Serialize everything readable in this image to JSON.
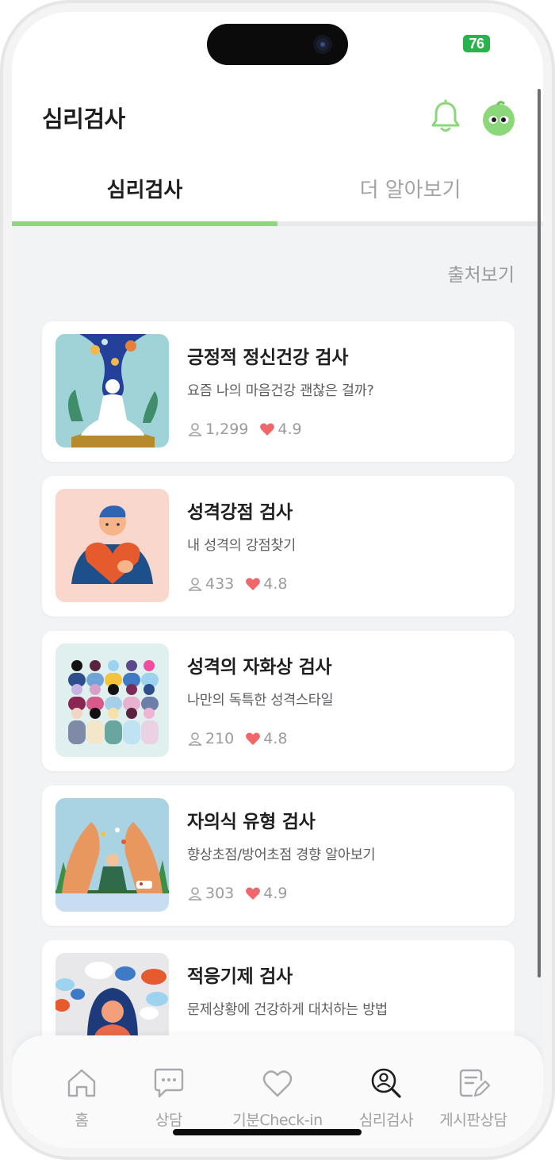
{
  "status_bar": {
    "battery": "76"
  },
  "header": {
    "title": "심리검사"
  },
  "tabs": [
    {
      "label": "심리검사",
      "active": true
    },
    {
      "label": "더 알아보기",
      "active": false
    }
  ],
  "source_link": "출처보기",
  "tests": [
    {
      "title": "긍정적 정신건강 검사",
      "subtitle": "요즘 나의 마음건강 괜찮은 걸까?",
      "participants": "1,299",
      "rating": "4.9",
      "thumb_bg": "#9fd3d8"
    },
    {
      "title": "성격강점 검사",
      "subtitle": "내 성격의 강점찾기",
      "participants": "433",
      "rating": "4.8",
      "thumb_bg": "#f9d7cc"
    },
    {
      "title": "성격의 자화상 검사",
      "subtitle": "나만의 독특한 성격스타일",
      "participants": "210",
      "rating": "4.8",
      "thumb_bg": "#dff0ee"
    },
    {
      "title": "자의식 유형 검사",
      "subtitle": "향상초점/방어초점 경향 알아보기",
      "participants": "303",
      "rating": "4.9",
      "thumb_bg": "#a9d3e2"
    },
    {
      "title": "적응기제 검사",
      "subtitle": "문제상황에 건강하게 대처하는 방법",
      "participants": "",
      "rating": "",
      "thumb_bg": "#e8e8ea"
    }
  ],
  "bottom_nav": [
    {
      "label": "홈",
      "icon": "home-icon",
      "active": false
    },
    {
      "label": "상담",
      "icon": "chat-bubble-icon",
      "active": false
    },
    {
      "label": "기분Check-in",
      "icon": "heart-icon",
      "active": false
    },
    {
      "label": "심리검사",
      "icon": "person-search-icon",
      "active": true
    },
    {
      "label": "게시판상담",
      "icon": "edit-note-icon",
      "active": false
    }
  ],
  "colors": {
    "accent": "#90d47e",
    "heart": "#f0666b",
    "brand_green": "#8bd77a"
  }
}
